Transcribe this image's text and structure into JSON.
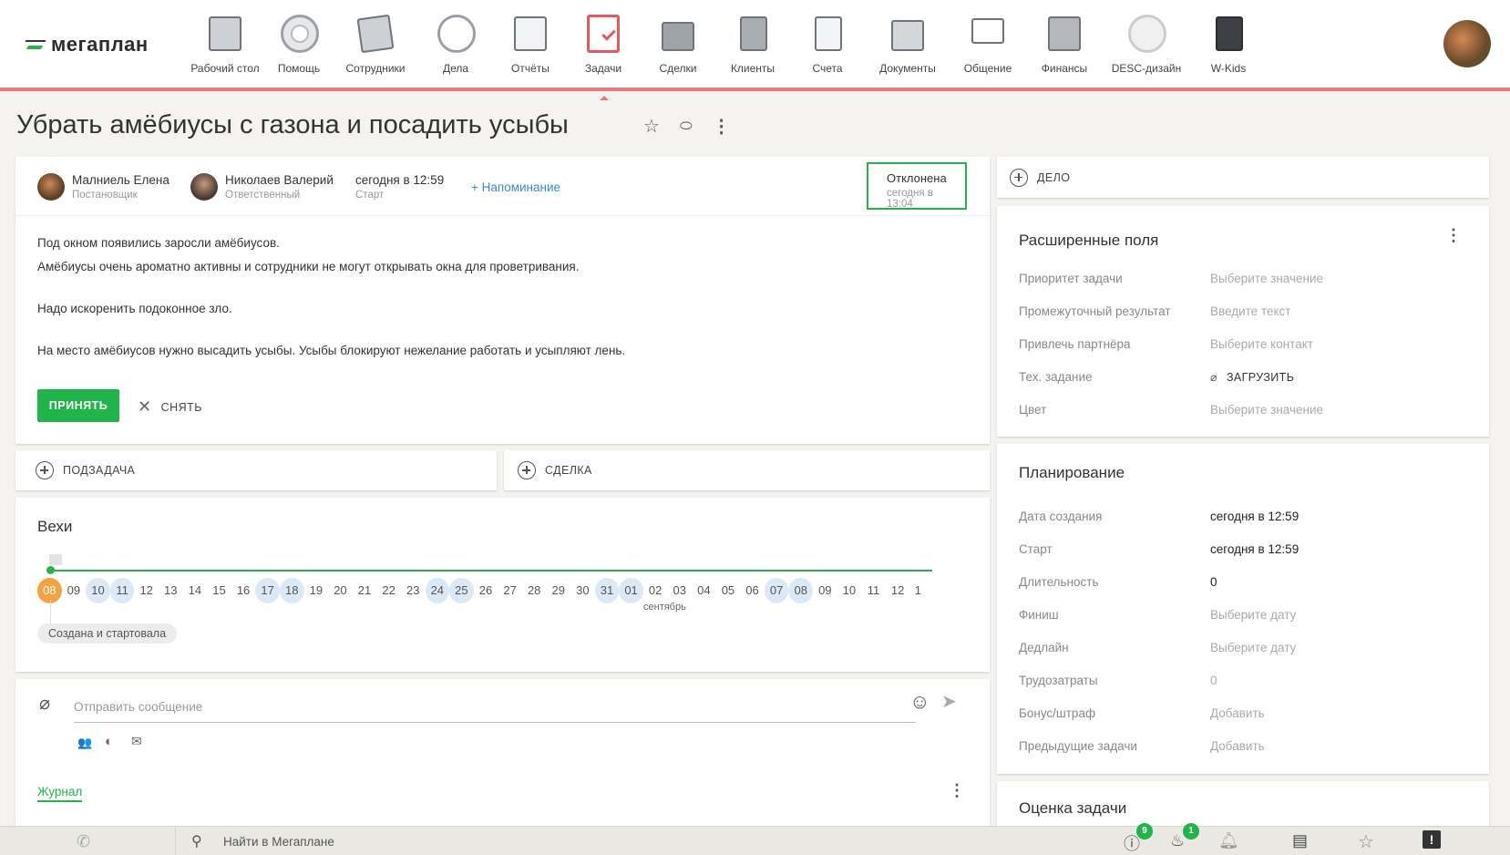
{
  "nav": {
    "logo": "мегаплан",
    "items": [
      {
        "label": "Рабочий стол",
        "icon": "desktop-icon"
      },
      {
        "label": "Помощь",
        "icon": "lifebuoy-icon"
      },
      {
        "label": "Сотрудники",
        "icon": "employees-icon"
      },
      {
        "label": "Дела",
        "icon": "clock-icon"
      },
      {
        "label": "Отчёты",
        "icon": "reports-icon"
      },
      {
        "label": "Задачи",
        "icon": "tasks-icon"
      },
      {
        "label": "Сделки",
        "icon": "briefcase-icon"
      },
      {
        "label": "Клиенты",
        "icon": "clients-icon"
      },
      {
        "label": "Счета",
        "icon": "invoice-icon"
      },
      {
        "label": "Документы",
        "icon": "folder-icon"
      },
      {
        "label": "Общение",
        "icon": "chat-icon"
      },
      {
        "label": "Финансы",
        "icon": "safe-icon"
      },
      {
        "label": "DESC-дизайн",
        "icon": "palette-icon"
      },
      {
        "label": "W-Kids",
        "icon": "download-icon"
      }
    ]
  },
  "task": {
    "title": "Убрать амёбиусы с газона и посадить усыбы",
    "owner": {
      "name": "Малниель Елена",
      "role": "Постановщик"
    },
    "responsible": {
      "name": "Николаев Валерий",
      "role": "Ответственный"
    },
    "start": {
      "value": "сегодня в 12:59",
      "label": "Старт"
    },
    "reminder": "+ Напоминание",
    "status": {
      "label": "Отклонена",
      "time": "сегодня в 13:04"
    },
    "description": [
      "Под окном появились заросли амёбиусов.",
      "Амёбиусы очень ароматно активны и сотрудники не могут открывать окна для проветривания.",
      "Надо искоренить подоконное зло.",
      "На место амёбиусов нужно высадить усыбы. Усыбы блокируют нежелание работать и усыпляют лень."
    ],
    "accept_label": "ПРИНЯТЬ",
    "remove_label": "СНЯТЬ"
  },
  "add": {
    "subtask": "ПОДЗАДАЧА",
    "deal": "СДЕЛКА",
    "case": "ДЕЛО"
  },
  "milestones": {
    "title": "Вехи",
    "days": [
      "08",
      "09",
      "10",
      "11",
      "12",
      "13",
      "14",
      "15",
      "16",
      "17",
      "18",
      "19",
      "20",
      "21",
      "22",
      "23",
      "24",
      "25",
      "26",
      "27",
      "28",
      "29",
      "30",
      "31",
      "01",
      "02",
      "03",
      "04",
      "05",
      "06",
      "07",
      "08",
      "09",
      "10",
      "11",
      "12",
      "1"
    ],
    "highlighted": [
      2,
      3,
      9,
      10,
      16,
      17,
      23,
      24,
      30,
      31
    ],
    "today_index": 0,
    "month": "сентябрь",
    "event": "Создана и стартовала"
  },
  "message": {
    "placeholder": "Отправить сообщение",
    "journal": "Журнал"
  },
  "ext_fields": {
    "title": "Расширенные поля",
    "items": [
      {
        "label": "Приоритет задачи",
        "value": "Выберите значение"
      },
      {
        "label": "Промежуточный результат",
        "value": "Введите текст"
      },
      {
        "label": "Привлечь партнёра",
        "value": "Выберите контакт"
      },
      {
        "label": "Тех. задание",
        "value": "ЗАГРУЗИТЬ"
      },
      {
        "label": "Цвет",
        "value": "Выберите значение"
      }
    ]
  },
  "planning": {
    "title": "Планирование",
    "items": [
      {
        "label": "Дата создания",
        "value": "сегодня в 12:59"
      },
      {
        "label": "Старт",
        "value": "сегодня в 12:59"
      },
      {
        "label": "Длительность",
        "value": "0"
      },
      {
        "label": "Финиш",
        "value": "Выберите дату"
      },
      {
        "label": "Дедлайн",
        "value": "Выберите дату"
      },
      {
        "label": "Трудозатраты",
        "value": "0"
      },
      {
        "label": "Бонус/штраф",
        "value": "Добавить"
      },
      {
        "label": "Предыдущие задачи",
        "value": "Добавить"
      }
    ]
  },
  "rating": {
    "title": "Оценка задачи"
  },
  "bottom": {
    "search": "Найти в Мегаплане",
    "badge_alerts": "9",
    "badge_fire": "1"
  }
}
